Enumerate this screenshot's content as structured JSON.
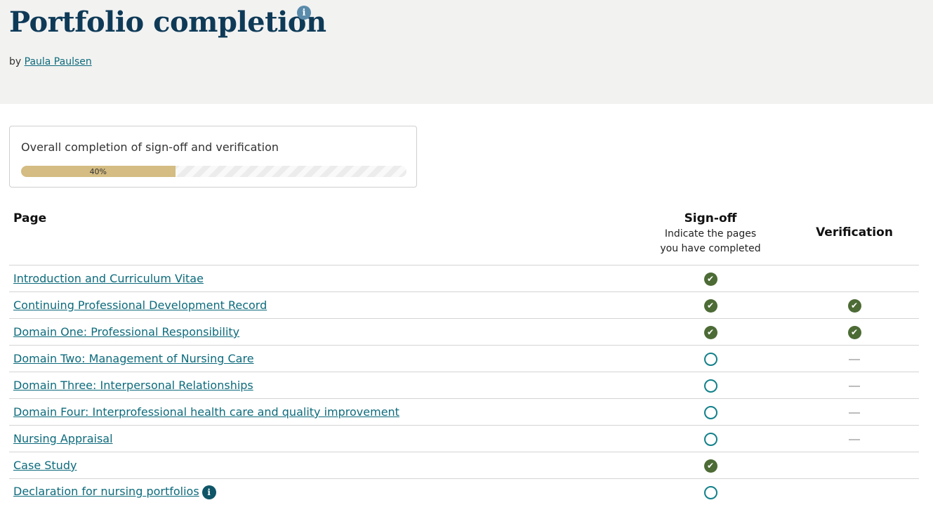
{
  "header": {
    "title": "Portfolio completion",
    "info_icon": "info-icon",
    "by_label": "by",
    "author": "Paula Paulsen"
  },
  "progress": {
    "label": "Overall completion of sign-off and verification",
    "percent_text": "40%",
    "value": 0.4
  },
  "table": {
    "headers": {
      "page": "Page",
      "signoff": "Sign-off",
      "signoff_sub1": "Indicate the pages",
      "signoff_sub2": "you have completed",
      "verification": "Verification"
    },
    "rows": [
      {
        "name": "Introduction and Curriculum Vitae",
        "signoff": "check",
        "verification": "none"
      },
      {
        "name": "Continuing Professional Development Record",
        "signoff": "check",
        "verification": "check"
      },
      {
        "name": "Domain One: Professional Responsibility",
        "signoff": "check",
        "verification": "check"
      },
      {
        "name": "Domain Two: Management of Nursing Care",
        "signoff": "circle",
        "verification": "dash"
      },
      {
        "name": "Domain Three: Interpersonal Relationships",
        "signoff": "circle",
        "verification": "dash"
      },
      {
        "name": "Domain Four: Interprofessional health care and quality improvement",
        "signoff": "circle",
        "verification": "dash"
      },
      {
        "name": "Nursing Appraisal",
        "signoff": "circle",
        "verification": "dash"
      },
      {
        "name": "Case Study",
        "signoff": "check",
        "verification": "none"
      },
      {
        "name": "Declaration for nursing portfolios",
        "signoff": "circle",
        "verification": "none",
        "has_info": true
      }
    ]
  },
  "colors": {
    "title": "#0e3a57",
    "link": "#0d6b7c",
    "check": "#4c6b35",
    "circle": "#12808a",
    "progress_fill": "#d4bc82"
  }
}
